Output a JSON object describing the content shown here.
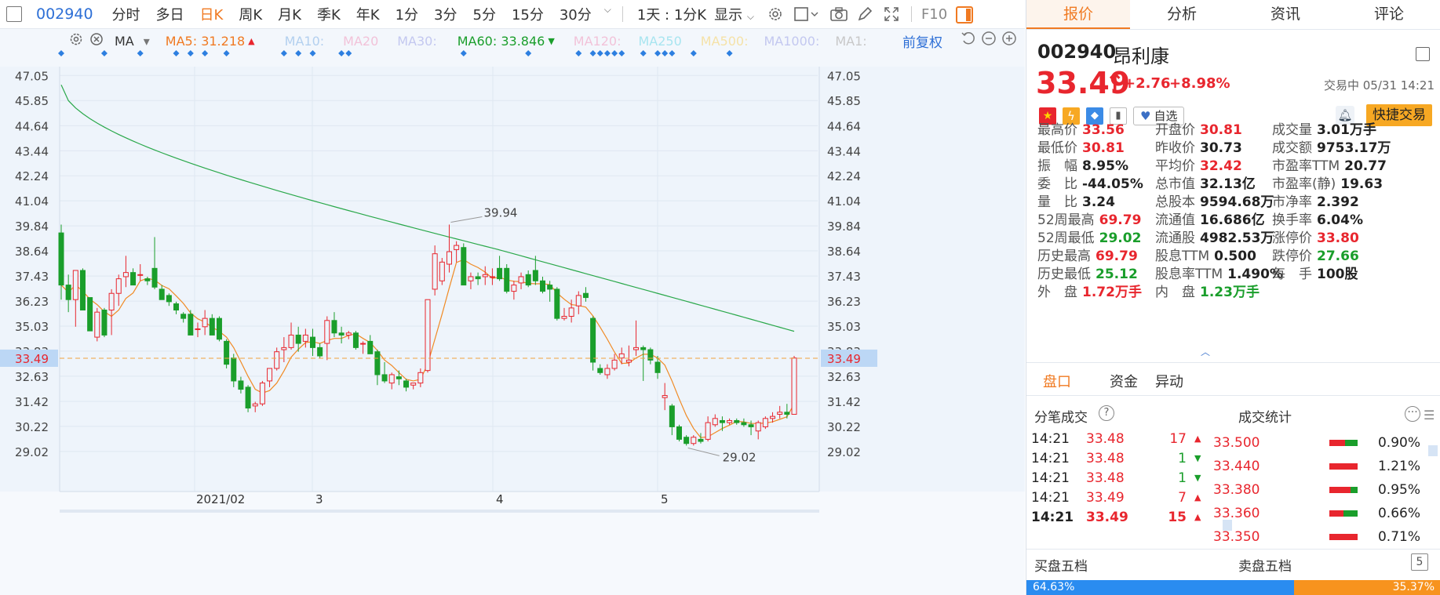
{
  "toolbar": {
    "code": "002940",
    "timeframes": [
      "分时",
      "多日",
      "日K",
      "周K",
      "月K",
      "季K",
      "年K",
      "1分",
      "3分",
      "5分",
      "15分",
      "30分"
    ],
    "active_timeframe": "日K",
    "multi": "1天 : 1分K",
    "display": "显示",
    "f10": "F10"
  },
  "chart": {
    "ma_label": "MA",
    "ma5": "MA5: 31.218",
    "ma10": "MA10:",
    "ma20": "MA20",
    "ma30": "MA30:",
    "ma60": "MA60: 33.846",
    "ma120": "MA120:",
    "ma250": "MA250",
    "ma500": "MA500:",
    "ma1000": "MA1000:",
    "ma1": "MA1:",
    "adjust": "前复权",
    "y_ticks": [
      "47.05",
      "45.85",
      "44.64",
      "43.44",
      "42.24",
      "41.04",
      "39.84",
      "38.64",
      "37.43",
      "36.23",
      "35.03",
      "33.83",
      "32.63",
      "31.42",
      "30.22",
      "29.02"
    ],
    "current_price": "33.49",
    "x_labels": [
      "2021/02",
      "3",
      "4",
      "5"
    ],
    "high_mark": "39.94",
    "low_mark": "29.02"
  },
  "chart_data": {
    "type": "candlestick",
    "ylim": [
      28.6,
      47.4
    ],
    "candles": [
      [
        39.5,
        39.9,
        36.3,
        37.0
      ],
      [
        37.0,
        37.5,
        35.7,
        36.3
      ],
      [
        36.3,
        37.7,
        35.0,
        37.7
      ],
      [
        37.7,
        37.8,
        35.8,
        35.8
      ],
      [
        36.4,
        36.4,
        34.8,
        34.8
      ],
      [
        34.5,
        35.9,
        34.3,
        35.7
      ],
      [
        35.8,
        35.9,
        34.5,
        34.6
      ],
      [
        35.8,
        36.8,
        34.6,
        36.6
      ],
      [
        36.6,
        37.5,
        36.0,
        37.3
      ],
      [
        37.4,
        38.4,
        36.9,
        37.6
      ],
      [
        37.6,
        37.8,
        37.0,
        37.0
      ],
      [
        37.5,
        38.0,
        37.2,
        37.5
      ],
      [
        37.3,
        37.4,
        37.0,
        37.2
      ],
      [
        37.8,
        39.3,
        36.8,
        36.9
      ],
      [
        36.8,
        37.0,
        36.3,
        36.3
      ],
      [
        36.5,
        36.6,
        36.0,
        36.2
      ],
      [
        36.1,
        36.2,
        35.6,
        35.8
      ],
      [
        35.6,
        35.7,
        35.2,
        35.4
      ],
      [
        35.6,
        35.8,
        34.6,
        34.6
      ],
      [
        34.9,
        35.2,
        34.5,
        34.9
      ],
      [
        35.0,
        35.8,
        34.6,
        35.4
      ],
      [
        35.4,
        35.6,
        34.8,
        34.6
      ],
      [
        35.4,
        35.5,
        34.3,
        34.4
      ],
      [
        34.3,
        34.4,
        33.0,
        33.2
      ],
      [
        33.5,
        33.7,
        32.1,
        32.4
      ],
      [
        32.4,
        32.6,
        31.8,
        32.0
      ],
      [
        32.1,
        32.2,
        30.9,
        31.1
      ],
      [
        31.2,
        31.4,
        30.9,
        31.3
      ],
      [
        31.3,
        32.4,
        31.2,
        32.3
      ],
      [
        32.4,
        33.0,
        32.1,
        33.0
      ],
      [
        33.0,
        34.0,
        32.9,
        33.8
      ],
      [
        33.9,
        34.5,
        33.3,
        34.0
      ],
      [
        34.0,
        35.2,
        33.9,
        34.6
      ],
      [
        34.6,
        35.0,
        33.8,
        34.2
      ],
      [
        34.3,
        34.9,
        34.0,
        34.6
      ],
      [
        34.5,
        34.9,
        33.6,
        34.0
      ],
      [
        34.0,
        34.2,
        33.5,
        33.6
      ],
      [
        34.2,
        35.5,
        33.4,
        35.3
      ],
      [
        35.3,
        35.7,
        34.5,
        34.7
      ],
      [
        34.7,
        35.0,
        34.2,
        34.6
      ],
      [
        34.6,
        34.8,
        34.4,
        34.7
      ],
      [
        34.7,
        34.8,
        33.9,
        34.0
      ],
      [
        34.2,
        34.3,
        33.7,
        34.2
      ],
      [
        34.3,
        34.6,
        33.8,
        33.7
      ],
      [
        33.8,
        33.9,
        32.2,
        32.7
      ],
      [
        32.7,
        33.3,
        32.3,
        32.4
      ],
      [
        32.3,
        32.8,
        32.0,
        32.7
      ],
      [
        32.6,
        32.9,
        32.2,
        32.5
      ],
      [
        32.4,
        32.5,
        31.9,
        32.1
      ],
      [
        32.2,
        32.3,
        32.0,
        32.3
      ],
      [
        32.3,
        33.0,
        32.1,
        32.8
      ],
      [
        32.9,
        36.3,
        32.8,
        36.3
      ],
      [
        36.8,
        38.9,
        36.5,
        38.5
      ],
      [
        37.2,
        38.3,
        37.0,
        38.1
      ],
      [
        38.0,
        39.9,
        37.6,
        38.6
      ],
      [
        38.7,
        39.1,
        38.1,
        38.9
      ],
      [
        38.8,
        39.0,
        37.0,
        37.0
      ],
      [
        37.2,
        37.6,
        36.8,
        37.4
      ],
      [
        37.4,
        37.6,
        37.0,
        37.3
      ],
      [
        37.4,
        37.9,
        37.0,
        37.5
      ],
      [
        37.4,
        37.8,
        37.0,
        37.4
      ],
      [
        37.8,
        38.4,
        37.2,
        37.3
      ],
      [
        37.8,
        38.0,
        36.6,
        36.7
      ],
      [
        36.7,
        37.2,
        36.3,
        37.0
      ],
      [
        37.1,
        37.6,
        36.8,
        37.4
      ],
      [
        37.5,
        37.7,
        36.9,
        37.0
      ],
      [
        37.7,
        38.4,
        37.0,
        37.2
      ],
      [
        37.2,
        37.4,
        36.6,
        36.7
      ],
      [
        37.0,
        37.2,
        36.2,
        36.8
      ],
      [
        36.8,
        36.9,
        35.3,
        35.4
      ],
      [
        35.4,
        35.9,
        35.3,
        35.5
      ],
      [
        35.5,
        36.3,
        35.2,
        35.9
      ],
      [
        36.0,
        36.7,
        35.6,
        36.5
      ],
      [
        36.6,
        36.9,
        36.2,
        36.4
      ],
      [
        35.4,
        35.5,
        32.9,
        33.3
      ],
      [
        33.0,
        33.2,
        32.7,
        32.8
      ],
      [
        32.7,
        33.2,
        32.5,
        33.0
      ],
      [
        33.0,
        33.7,
        32.9,
        33.4
      ],
      [
        33.5,
        34.0,
        33.2,
        33.7
      ],
      [
        33.3,
        34.1,
        33.1,
        33.4
      ],
      [
        33.9,
        35.3,
        33.6,
        34.0
      ],
      [
        34.0,
        34.1,
        32.4,
        33.9
      ],
      [
        33.9,
        34.0,
        33.2,
        33.4
      ],
      [
        33.3,
        33.6,
        32.5,
        32.8
      ],
      [
        31.6,
        32.3,
        31.0,
        31.7
      ],
      [
        31.2,
        31.3,
        29.8,
        30.2
      ],
      [
        30.2,
        30.3,
        29.5,
        29.6
      ],
      [
        29.7,
        29.8,
        29.3,
        29.4
      ],
      [
        29.4,
        29.8,
        29.3,
        29.7
      ],
      [
        29.6,
        29.9,
        29.4,
        29.5
      ],
      [
        29.6,
        30.7,
        29.5,
        30.4
      ],
      [
        30.3,
        30.8,
        30.2,
        30.6
      ],
      [
        30.5,
        30.7,
        30.0,
        30.4
      ],
      [
        30.4,
        30.6,
        30.3,
        30.5
      ],
      [
        30.5,
        30.6,
        30.3,
        30.4
      ],
      [
        30.4,
        30.6,
        30.2,
        30.3
      ],
      [
        30.3,
        30.5,
        29.8,
        30.2
      ],
      [
        30.0,
        30.5,
        29.6,
        30.4
      ],
      [
        30.2,
        30.7,
        30.1,
        30.6
      ],
      [
        30.6,
        30.9,
        30.4,
        30.7
      ],
      [
        30.8,
        31.2,
        30.6,
        30.9
      ],
      [
        30.9,
        31.3,
        30.6,
        30.8
      ],
      [
        30.8,
        33.6,
        30.8,
        33.5
      ]
    ]
  },
  "panel": {
    "tabs": [
      "报价",
      "分析",
      "资讯",
      "评论"
    ],
    "active_tab": "报价",
    "code": "002940",
    "name": "昂利康",
    "price": "33.49",
    "change": "+2.76",
    "change_pct": "+8.98%",
    "status": "交易中 05/31 14:21",
    "watch": "自选",
    "quick_trade": "快捷交易",
    "quote_rows": [
      [
        [
          "最高价",
          "33.56",
          "red"
        ],
        [
          "开盘价",
          "30.81",
          "red"
        ],
        [
          "成交量",
          "3.01万手",
          "dark"
        ]
      ],
      [
        [
          "最低价",
          "30.81",
          "red"
        ],
        [
          "昨收价",
          "30.73",
          "dark"
        ],
        [
          "成交额",
          "9753.17万",
          "dark"
        ]
      ],
      [
        [
          "振　幅",
          "8.95%",
          "dark"
        ],
        [
          "平均价",
          "32.42",
          "red"
        ],
        [
          "市盈率TTM",
          "20.77",
          "dark"
        ]
      ],
      [
        [
          "委　比",
          "-44.05%",
          "dark"
        ],
        [
          "总市值",
          "32.13亿",
          "dark"
        ],
        [
          "市盈率(静)",
          "19.63",
          "dark"
        ]
      ],
      [
        [
          "量　比",
          "3.24",
          "dark"
        ],
        [
          "总股本",
          "9594.68万",
          "dark"
        ],
        [
          "市净率",
          "2.392",
          "dark"
        ]
      ],
      [
        [
          "52周最高",
          "69.79",
          "red"
        ],
        [
          "流通值",
          "16.686亿",
          "dark"
        ],
        [
          "换手率",
          "6.04%",
          "dark"
        ]
      ],
      [
        [
          "52周最低",
          "29.02",
          "green"
        ],
        [
          "流通股",
          "4982.53万",
          "dark"
        ],
        [
          "涨停价",
          "33.80",
          "red"
        ]
      ],
      [
        [
          "历史最高",
          "69.79",
          "red"
        ],
        [
          "股息TTM",
          "0.500",
          "dark"
        ],
        [
          "跌停价",
          "27.66",
          "green"
        ]
      ],
      [
        [
          "历史最低",
          "25.12",
          "green"
        ],
        [
          "股息率TTM",
          "1.490%",
          "dark"
        ],
        [
          "每　手",
          "100股",
          "dark"
        ]
      ],
      [
        [
          "外　盘",
          "1.72万手",
          "red"
        ],
        [
          "内　盘",
          "1.23万手",
          "green"
        ],
        [
          "",
          "",
          ""
        ]
      ]
    ],
    "sub_tabs": [
      "盘口",
      "资金",
      "异动"
    ],
    "active_sub_tab": "盘口",
    "ticks_title": "分笔成交",
    "stats_title": "成交统计",
    "ticks": [
      {
        "time": "14:21",
        "price": "33.48",
        "vol": "17",
        "dir": "up"
      },
      {
        "time": "14:21",
        "price": "33.48",
        "vol": "1",
        "dir": "down"
      },
      {
        "time": "14:21",
        "price": "33.48",
        "vol": "1",
        "dir": "down"
      },
      {
        "time": "14:21",
        "price": "33.49",
        "vol": "7",
        "dir": "up"
      },
      {
        "time": "14:21",
        "price": "33.49",
        "vol": "15",
        "dir": "up"
      }
    ],
    "stats": [
      {
        "price": "33.500",
        "pct": "0.90%",
        "red": 0.55
      },
      {
        "price": "33.440",
        "pct": "1.21%",
        "red": 1.0
      },
      {
        "price": "33.380",
        "pct": "0.95%",
        "red": 0.75
      },
      {
        "price": "33.360",
        "pct": "0.66%",
        "red": 0.5
      },
      {
        "price": "33.350",
        "pct": "0.71%",
        "red": 1.0
      }
    ],
    "buy5": "买盘五档",
    "sell5": "卖盘五档",
    "buy_pct": "64.63%",
    "sell_pct": "35.37%",
    "buy_share": 0.6463
  }
}
